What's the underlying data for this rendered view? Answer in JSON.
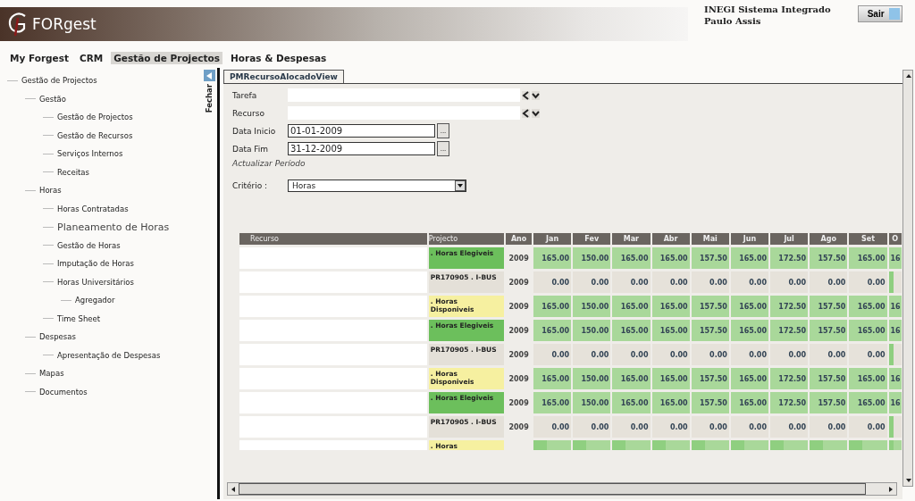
{
  "header": {
    "logo": "FORgest",
    "system": "INEGI Sistema Integrado",
    "user": "Paulo Assis",
    "logout": "Sair"
  },
  "menu": [
    {
      "label": "My Forgest",
      "selected": false
    },
    {
      "label": "CRM",
      "selected": false
    },
    {
      "label": "Gestão de Projectos",
      "selected": true
    },
    {
      "label": "Horas & Despesas",
      "selected": false
    }
  ],
  "sidebar": {
    "collapse_label": "Fechar",
    "tree": [
      {
        "label": "Gestão de Projectos",
        "hovered": false,
        "children": [
          {
            "label": "Gestão",
            "hovered": false,
            "children": [
              {
                "label": "Gestão de Projectos",
                "hovered": false
              },
              {
                "label": "Gestão de Recursos",
                "hovered": false
              },
              {
                "label": "Serviços Internos",
                "hovered": false
              },
              {
                "label": "Receitas",
                "hovered": false
              }
            ]
          },
          {
            "label": "Horas",
            "hovered": false,
            "children": [
              {
                "label": "Horas Contratadas",
                "hovered": false
              },
              {
                "label": "Planeamento de Horas",
                "hovered": true
              },
              {
                "label": "Gestão de Horas",
                "hovered": false
              },
              {
                "label": "Imputação de Horas",
                "hovered": false
              },
              {
                "label": "Horas Universitários",
                "hovered": false,
                "children": [
                  {
                    "label": "Agregador",
                    "hovered": false
                  }
                ]
              },
              {
                "label": "Time Sheet",
                "hovered": false
              }
            ]
          },
          {
            "label": "Despesas",
            "hovered": false,
            "children": [
              {
                "label": "Apresentação de Despesas",
                "hovered": false
              }
            ]
          },
          {
            "label": "Mapas",
            "hovered": false
          },
          {
            "label": "Documentos",
            "hovered": false
          }
        ]
      }
    ]
  },
  "tab": {
    "label": "PMRecursoAlocadoView",
    "selected": true
  },
  "form": {
    "lookups": [
      {
        "label": "Tarefa"
      },
      {
        "label": "Recurso"
      }
    ],
    "dates": [
      {
        "label": "Data Inicio",
        "value": "01-01-2009",
        "button": "..."
      },
      {
        "label": "Data Fim",
        "value": "31-12-2009",
        "button": "..."
      }
    ],
    "update_link": "Actualizar Período",
    "criterio": {
      "label": "Critério :",
      "value": "Horas"
    }
  },
  "table": {
    "columns": [
      "Recurso",
      "Projecto",
      "Ano",
      "Jan",
      "Fev",
      "Mar",
      "Abr",
      "Mai",
      "Jun",
      "Jul",
      "Ago",
      "Set",
      "O"
    ],
    "rows": [
      {
        "kind": "eligible",
        "project": ". Horas Elegiveis",
        "year": "2009",
        "values": [
          "165.00",
          "150.00",
          "165.00",
          "165.00",
          "157.50",
          "165.00",
          "172.50",
          "157.50",
          "165.00",
          "16"
        ]
      },
      {
        "kind": "project",
        "project": "PR170905 . I-BUS",
        "year": "2009",
        "values": [
          "0.00",
          "0.00",
          "0.00",
          "0.00",
          "0.00",
          "0.00",
          "0.00",
          "0.00",
          "0.00"
        ]
      },
      {
        "kind": "available",
        "project": ". Horas Disponiveis",
        "year": "2009",
        "values": [
          "165.00",
          "150.00",
          "165.00",
          "165.00",
          "157.50",
          "165.00",
          "172.50",
          "157.50",
          "165.00",
          "16"
        ]
      },
      {
        "kind": "eligible",
        "project": ". Horas Elegiveis",
        "year": "2009",
        "values": [
          "165.00",
          "150.00",
          "165.00",
          "165.00",
          "157.50",
          "165.00",
          "172.50",
          "157.50",
          "165.00",
          "16"
        ]
      },
      {
        "kind": "project",
        "project": "PR170905 . I-BUS",
        "year": "2009",
        "values": [
          "0.00",
          "0.00",
          "0.00",
          "0.00",
          "0.00",
          "0.00",
          "0.00",
          "0.00",
          "0.00"
        ]
      },
      {
        "kind": "available",
        "project": ". Horas Disponiveis",
        "year": "2009",
        "values": [
          "165.00",
          "150.00",
          "165.00",
          "165.00",
          "157.50",
          "165.00",
          "172.50",
          "157.50",
          "165.00",
          "16"
        ]
      },
      {
        "kind": "eligible",
        "project": ". Horas Elegiveis",
        "year": "2009",
        "values": [
          "165.00",
          "150.00",
          "165.00",
          "165.00",
          "157.50",
          "165.00",
          "172.50",
          "157.50",
          "165.00",
          "16"
        ]
      },
      {
        "kind": "project",
        "project": "PR170905 . I-BUS",
        "year": "2009",
        "values": [
          "0.00",
          "0.00",
          "0.00",
          "0.00",
          "0.00",
          "0.00",
          "0.00",
          "0.00",
          "0.00"
        ]
      },
      {
        "kind": "available",
        "project": ". Horas"
      }
    ]
  }
}
